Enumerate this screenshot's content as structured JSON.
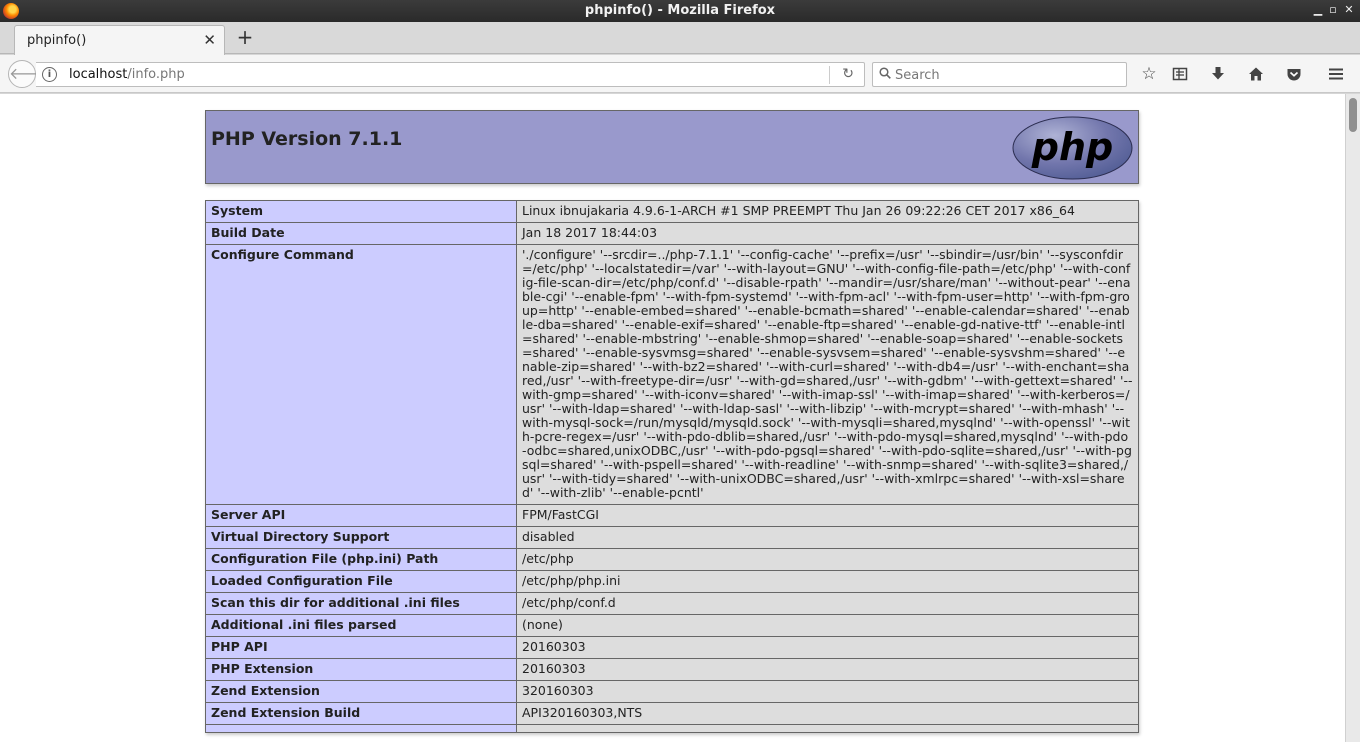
{
  "window": {
    "title": "phpinfo() - Mozilla Firefox",
    "min_label": "▁",
    "max_label": "▫",
    "close_label": "✕"
  },
  "tabs": [
    {
      "label": "phpinfo()"
    }
  ],
  "navbar": {
    "url_host": "localhost",
    "url_path": "/info.php",
    "search_placeholder": "Search"
  },
  "icons": {
    "back": "arrow-left",
    "info": "info-circle",
    "reload": "reload",
    "search": "magnifier",
    "bookmark": "star",
    "library": "reading-list",
    "download": "download-arrow",
    "home": "home",
    "pocket": "pocket",
    "menu": "hamburger"
  },
  "colors": {
    "header_bg": "#9999cc",
    "label_bg": "#ccccff",
    "value_bg": "#dddddd"
  },
  "page": {
    "heading": "PHP Version 7.1.1",
    "logo_text": "php",
    "rows": [
      {
        "label": "System",
        "value": "Linux ibnujakaria 4.9.6-1-ARCH #1 SMP PREEMPT Thu Jan 26 09:22:26 CET 2017 x86_64"
      },
      {
        "label": "Build Date",
        "value": "Jan 18 2017 18:44:03"
      },
      {
        "label": "Configure Command",
        "value": "'./configure' '--srcdir=../php-7.1.1' '--config-cache' '--prefix=/usr' '--sbindir=/usr/bin' '--sysconfdir=/etc/php' '--localstatedir=/var' '--with-layout=GNU' '--with-config-file-path=/etc/php' '--with-config-file-scan-dir=/etc/php/conf.d' '--disable-rpath' '--mandir=/usr/share/man' '--without-pear' '--enable-cgi' '--enable-fpm' '--with-fpm-systemd' '--with-fpm-acl' '--with-fpm-user=http' '--with-fpm-group=http' '--enable-embed=shared' '--enable-bcmath=shared' '--enable-calendar=shared' '--enable-dba=shared' '--enable-exif=shared' '--enable-ftp=shared' '--enable-gd-native-ttf' '--enable-intl=shared' '--enable-mbstring' '--enable-shmop=shared' '--enable-soap=shared' '--enable-sockets=shared' '--enable-sysvmsg=shared' '--enable-sysvsem=shared' '--enable-sysvshm=shared' '--enable-zip=shared' '--with-bz2=shared' '--with-curl=shared' '--with-db4=/usr' '--with-enchant=shared,/usr' '--with-freetype-dir=/usr' '--with-gd=shared,/usr' '--with-gdbm' '--with-gettext=shared' '--with-gmp=shared' '--with-iconv=shared' '--with-imap-ssl' '--with-imap=shared' '--with-kerberos=/usr' '--with-ldap=shared' '--with-ldap-sasl' '--with-libzip' '--with-mcrypt=shared' '--with-mhash' '--with-mysql-sock=/run/mysqld/mysqld.sock' '--with-mysqli=shared,mysqlnd' '--with-openssl' '--with-pcre-regex=/usr' '--with-pdo-dblib=shared,/usr' '--with-pdo-mysql=shared,mysqlnd' '--with-pdo-odbc=shared,unixODBC,/usr' '--with-pdo-pgsql=shared' '--with-pdo-sqlite=shared,/usr' '--with-pgsql=shared' '--with-pspell=shared' '--with-readline' '--with-snmp=shared' '--with-sqlite3=shared,/usr' '--with-tidy=shared' '--with-unixODBC=shared,/usr' '--with-xmlrpc=shared' '--with-xsl=shared' '--with-zlib' '--enable-pcntl'"
      },
      {
        "label": "Server API",
        "value": "FPM/FastCGI"
      },
      {
        "label": "Virtual Directory Support",
        "value": "disabled"
      },
      {
        "label": "Configuration File (php.ini) Path",
        "value": "/etc/php"
      },
      {
        "label": "Loaded Configuration File",
        "value": "/etc/php/php.ini"
      },
      {
        "label": "Scan this dir for additional .ini files",
        "value": "/etc/php/conf.d"
      },
      {
        "label": "Additional .ini files parsed",
        "value": "(none)"
      },
      {
        "label": "PHP API",
        "value": "20160303"
      },
      {
        "label": "PHP Extension",
        "value": "20160303"
      },
      {
        "label": "Zend Extension",
        "value": "320160303"
      },
      {
        "label": "Zend Extension Build",
        "value": "API320160303,NTS"
      },
      {
        "label": "",
        "value": ""
      }
    ]
  }
}
